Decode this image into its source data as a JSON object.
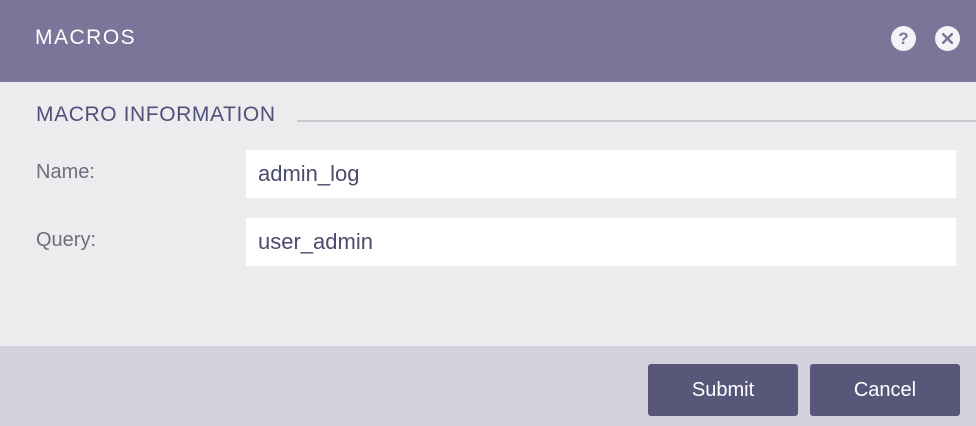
{
  "header": {
    "title": "MACROS",
    "help_icon": "question-mark-icon",
    "close_icon": "close-icon",
    "help_glyph": "?"
  },
  "section": {
    "title": "MACRO INFORMATION"
  },
  "form": {
    "name_label": "Name:",
    "name_value": "admin_log",
    "query_label": "Query:",
    "query_value": "user_admin"
  },
  "footer": {
    "submit_label": "Submit",
    "cancel_label": "Cancel"
  },
  "colors": {
    "header_bg": "#7a7599",
    "body_bg": "#ececef",
    "footer_bg": "#d3d2dc",
    "button_bg": "#58577a"
  }
}
